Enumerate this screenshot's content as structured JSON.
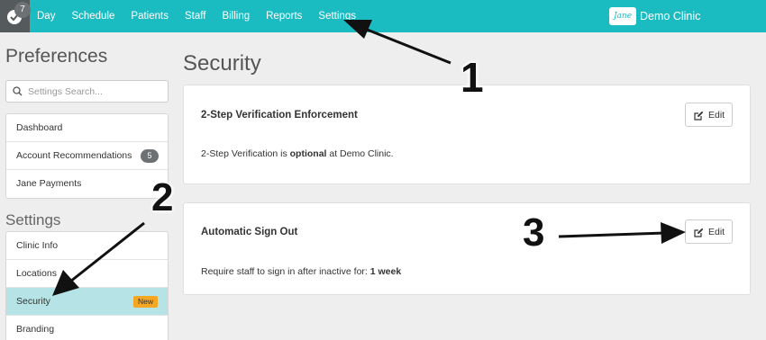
{
  "topbar": {
    "notification_count": "7",
    "nav": [
      "Day",
      "Schedule",
      "Patients",
      "Staff",
      "Billing",
      "Reports",
      "Settings"
    ],
    "brand_logo_text": "Jane",
    "clinic_name": "Demo Clinic"
  },
  "sidebar": {
    "preferences_title": "Preferences",
    "search_placeholder": "Settings Search...",
    "preferences_items": [
      {
        "label": "Dashboard"
      },
      {
        "label": "Account Recommendations",
        "badge": "5"
      },
      {
        "label": "Jane Payments"
      }
    ],
    "settings_title": "Settings",
    "settings_items": [
      {
        "label": "Clinic Info"
      },
      {
        "label": "Locations"
      },
      {
        "label": "Security",
        "badge": "New"
      },
      {
        "label": "Branding"
      }
    ]
  },
  "main": {
    "title": "Security",
    "cards": [
      {
        "title": "2-Step Verification Enforcement",
        "text_before": "2-Step Verification is ",
        "text_bold": "optional",
        "text_after": " at Demo Clinic.",
        "edit_label": "Edit"
      },
      {
        "title": "Automatic Sign Out",
        "text_before": "Require staff to sign in after inactive for: ",
        "text_bold": "1 week",
        "text_after": "",
        "edit_label": "Edit"
      }
    ]
  },
  "annotations": {
    "step_1": "1",
    "step_2": "2",
    "step_3": "3"
  },
  "colors": {
    "topbar": "#1abcc2",
    "active_item": "#b6e4e6",
    "new_badge": "#f5a623"
  }
}
